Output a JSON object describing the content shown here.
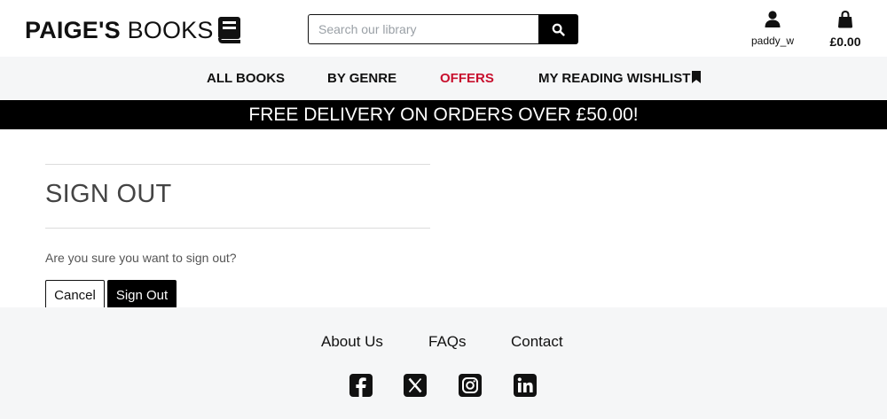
{
  "header": {
    "logo_bold": "PAIGE'S",
    "logo_light": "BOOKS",
    "search_placeholder": "Search our library",
    "account_label": "paddy_w",
    "bag_total": "£0.00"
  },
  "nav": {
    "items": [
      "ALL BOOKS",
      "BY GENRE",
      "OFFERS",
      "MY READING WISHLIST"
    ]
  },
  "banner": "FREE DELIVERY ON ORDERS OVER £50.00!",
  "main": {
    "title": "SIGN OUT",
    "question": "Are you sure you want to sign out?",
    "cancel_label": "Cancel",
    "signout_label": "Sign Out"
  },
  "footer": {
    "links": [
      "About Us",
      "FAQs",
      "Contact"
    ],
    "social_icons": [
      "facebook-icon",
      "x-icon",
      "instagram-icon",
      "linkedin-icon"
    ]
  },
  "colors": {
    "accent_offers": "#c8102e",
    "nav_bg": "#f5f6f7",
    "banner_bg": "#000000"
  }
}
